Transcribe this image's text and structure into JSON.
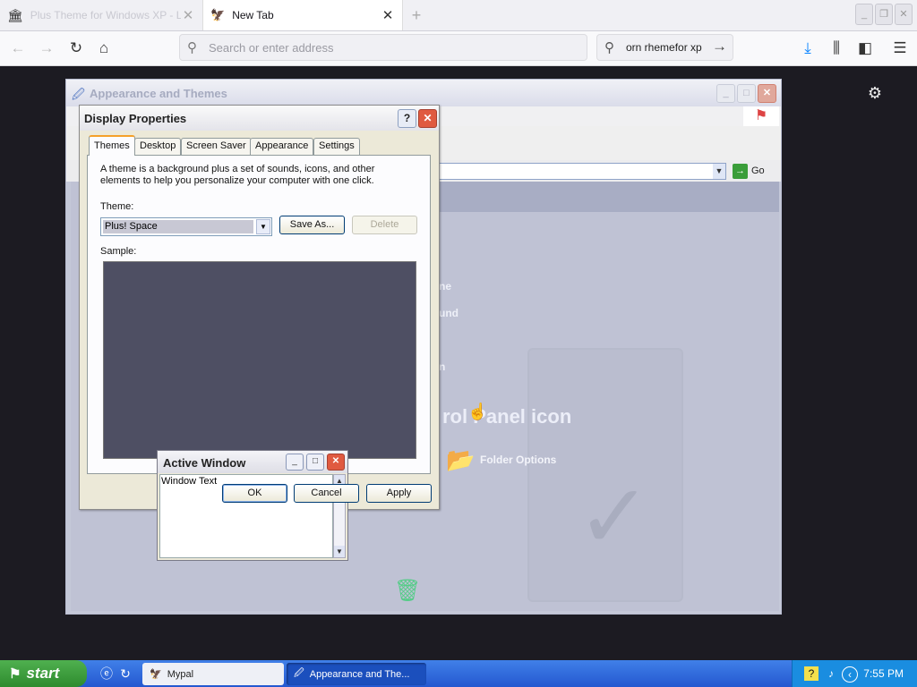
{
  "browser": {
    "tabs": [
      {
        "label": "Plus Theme for Windows XP - Lo..",
        "active": false
      },
      {
        "label": "New Tab",
        "active": true
      }
    ],
    "new_tab_icon": "plus-icon",
    "address_placeholder": "Search or enter address",
    "search_query": "orn rhemefor xp",
    "toolbar_icons": [
      "back-icon",
      "forward-icon",
      "reload-icon",
      "home-icon",
      "download-icon",
      "library-icon",
      "sidebar-icon",
      "menu-icon"
    ]
  },
  "appearance_window": {
    "title": "Appearance and Themes",
    "go_label": "Go",
    "content_fragments": [
      "ne",
      "und",
      "n"
    ],
    "big_text": "rol Panel icon",
    "folder_label": "Folder Options"
  },
  "display_properties": {
    "title": "Display Properties",
    "help": "?",
    "close": "✕",
    "tabs": [
      "Themes",
      "Desktop",
      "Screen Saver",
      "Appearance",
      "Settings"
    ],
    "active_tab": "Themes",
    "description": "A theme is a background plus a set of sounds, icons, and other elements to help you personalize your computer with one click.",
    "theme_label": "Theme:",
    "theme_value": "Plus! Space",
    "save_as": "Save As...",
    "delete": "Delete",
    "sample_label": "Sample:",
    "preview_title": "Active Window",
    "preview_text": "Window Text",
    "ok": "OK",
    "cancel": "Cancel",
    "apply": "Apply"
  },
  "taskbar": {
    "start": "start",
    "tasks": [
      "Mypal",
      "Appearance and The..."
    ],
    "clock": "7:55 PM"
  },
  "colors": {
    "taskbar": "#2458d0",
    "start": "#3a9b3a",
    "dialog": "#ece9d8"
  }
}
